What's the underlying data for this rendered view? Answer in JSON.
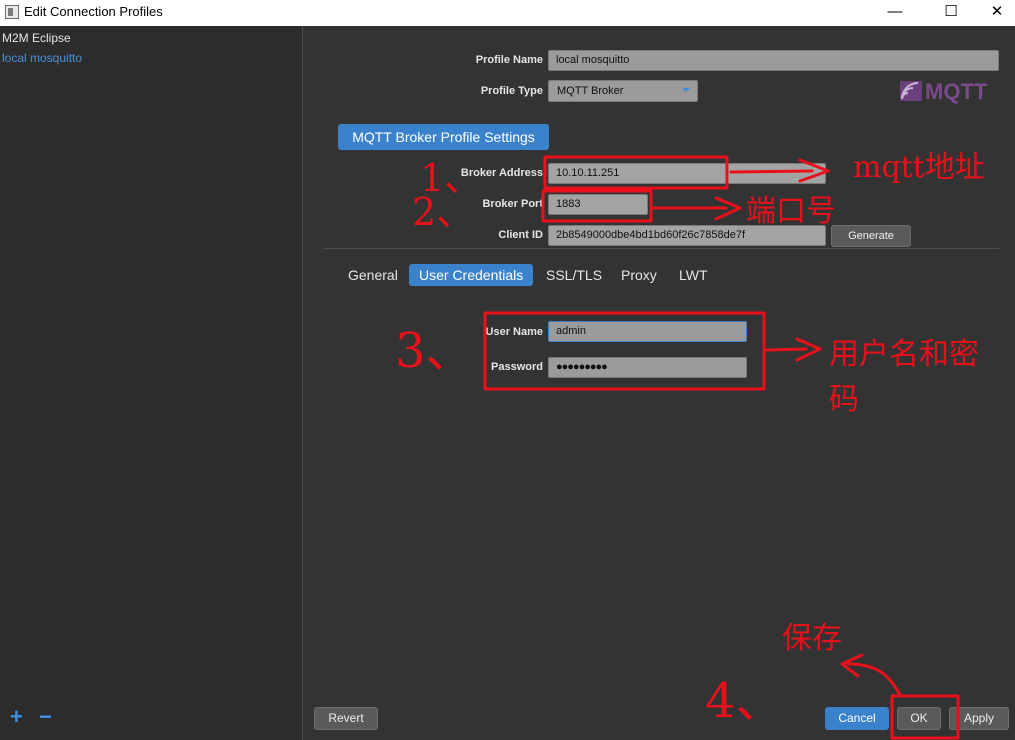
{
  "window": {
    "title": "Edit Connection Profiles",
    "minimize_glyph": "—",
    "maximize_glyph": "☐",
    "close_glyph": "✕"
  },
  "profiles": {
    "items": [
      "M2M Eclipse",
      "local mosquitto"
    ],
    "selected_index": 1,
    "add_glyph": "+",
    "remove_glyph": "−"
  },
  "profile": {
    "name_label": "Profile Name",
    "name_value": "local mosquitto",
    "type_label": "Profile Type",
    "type_value": "MQTT Broker",
    "logo_text": "MQTT"
  },
  "broker": {
    "section_title": "MQTT Broker Profile Settings",
    "address_label": "Broker Address",
    "address_value": "10.10.11.251",
    "port_label": "Broker Port",
    "port_value": "1883",
    "client_id_label": "Client ID",
    "client_id_value": "2b8549000dbe4bd1bd60f26c7858de7f",
    "generate_label": "Generate"
  },
  "tabs": {
    "items": [
      "General",
      "User Credentials",
      "SSL/TLS",
      "Proxy",
      "LWT"
    ],
    "active_index": 1
  },
  "credentials": {
    "username_label": "User Name",
    "username_value": "admin",
    "password_label": "Password",
    "password_value": "●●●●●●●●●"
  },
  "footer": {
    "revert_label": "Revert",
    "cancel_label": "Cancel",
    "ok_label": "OK",
    "apply_label": "Apply"
  },
  "annotations": {
    "n1": "1、",
    "n2": "2、",
    "n3": "3、",
    "n4": "4、",
    "address_note": "mqtt地址",
    "port_note": "端口号",
    "cred_note_line1": "用户名和密",
    "cred_note_line2": "码",
    "save_note": "保存",
    "color": "#e8101a"
  },
  "colors": {
    "accent": "#3b82cc",
    "selected_text": "#4a90d9",
    "annotation": "#e8101a"
  }
}
